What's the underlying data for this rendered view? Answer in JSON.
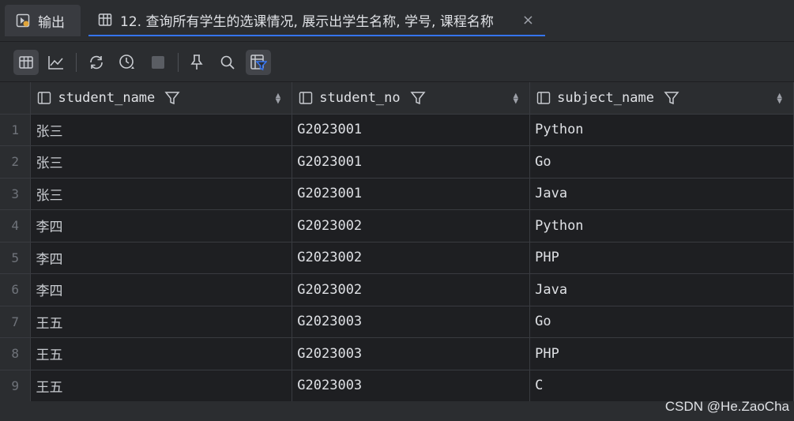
{
  "tabs": {
    "output_label": "输出",
    "query_label": "12. 查询所有学生的选课情况, 展示出学生名称, 学号, 课程名称",
    "close_glyph": "×"
  },
  "toolbar": {
    "buttons": [
      "table-view-icon",
      "chart-view-icon",
      "refresh-icon",
      "history-icon",
      "stop-icon",
      "pin-icon",
      "search-icon",
      "filter-icon"
    ]
  },
  "grid": {
    "columns": [
      {
        "name": "student_name"
      },
      {
        "name": "student_no"
      },
      {
        "name": "subject_name"
      }
    ],
    "rows": [
      {
        "num": "1",
        "student_name": "张三",
        "student_no": "G2023001",
        "subject_name": "Python"
      },
      {
        "num": "2",
        "student_name": "张三",
        "student_no": "G2023001",
        "subject_name": "Go"
      },
      {
        "num": "3",
        "student_name": "张三",
        "student_no": "G2023001",
        "subject_name": "Java"
      },
      {
        "num": "4",
        "student_name": "李四",
        "student_no": "G2023002",
        "subject_name": "Python"
      },
      {
        "num": "5",
        "student_name": "李四",
        "student_no": "G2023002",
        "subject_name": "PHP"
      },
      {
        "num": "6",
        "student_name": "李四",
        "student_no": "G2023002",
        "subject_name": "Java"
      },
      {
        "num": "7",
        "student_name": "王五",
        "student_no": "G2023003",
        "subject_name": "Go"
      },
      {
        "num": "8",
        "student_name": "王五",
        "student_no": "G2023003",
        "subject_name": "PHP"
      },
      {
        "num": "9",
        "student_name": "王五",
        "student_no": "G2023003",
        "subject_name": "C"
      }
    ]
  },
  "watermark": "CSDN @He.ZaoCha",
  "colors": {
    "accent": "#3574f0",
    "background": "#1e1f22",
    "panel": "#2b2d30"
  }
}
